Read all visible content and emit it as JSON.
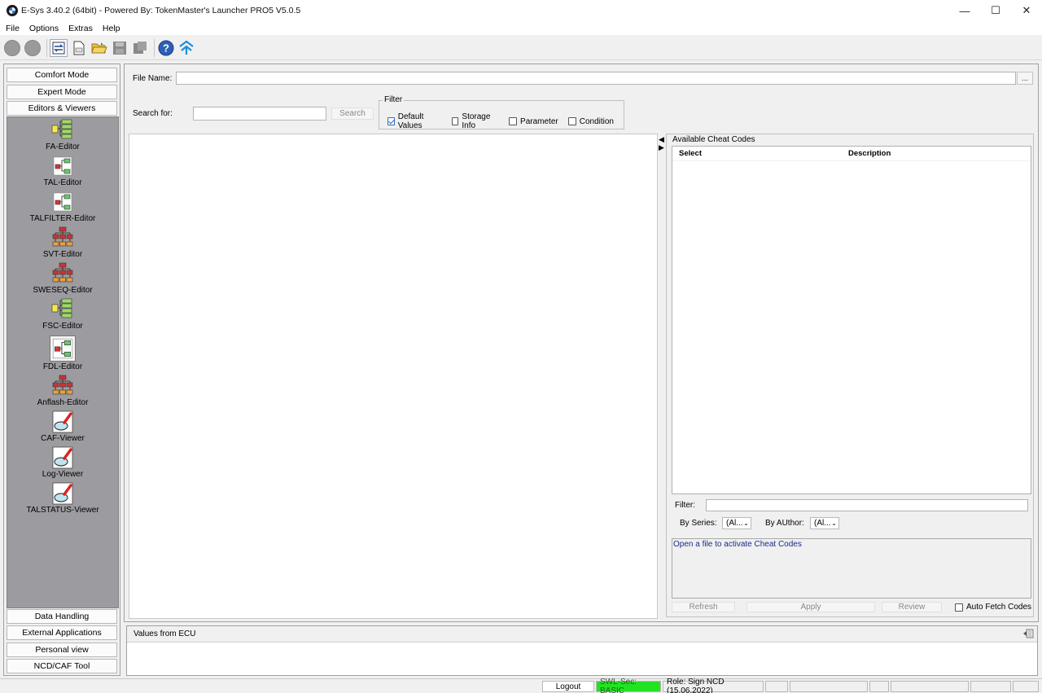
{
  "window": {
    "title": "E-Sys 3.40.2  (64bit) - Powered By: TokenMaster's Launcher PRO5 V5.0.5",
    "controls": [
      "minimize",
      "maximize",
      "close"
    ]
  },
  "menu": {
    "items": [
      "File",
      "Options",
      "Extras",
      "Help"
    ]
  },
  "toolbar": {
    "icons": [
      "back-icon",
      "forward-icon",
      "connect-icon",
      "new-file-icon",
      "open-folder-icon",
      "save-icon",
      "save-as-icon",
      "help-icon",
      "launcher-icon"
    ]
  },
  "sidebar": {
    "top_buttons": [
      "Comfort Mode",
      "Expert Mode",
      "Editors & Viewers"
    ],
    "editors": [
      {
        "label": "FA-Editor",
        "icon": "fa-editor-icon"
      },
      {
        "label": "TAL-Editor",
        "icon": "tal-editor-icon"
      },
      {
        "label": "TALFILTER-Editor",
        "icon": "talfilter-editor-icon"
      },
      {
        "label": "SVT-Editor",
        "icon": "svt-editor-icon"
      },
      {
        "label": "SWESEQ-Editor",
        "icon": "sweseq-editor-icon"
      },
      {
        "label": "FSC-Editor",
        "icon": "fsc-editor-icon"
      },
      {
        "label": "FDL-Editor",
        "icon": "fdl-editor-icon"
      },
      {
        "label": "Anflash-Editor",
        "icon": "anflash-editor-icon"
      },
      {
        "label": "CAF-Viewer",
        "icon": "caf-viewer-icon"
      },
      {
        "label": "Log-Viewer",
        "icon": "log-viewer-icon"
      },
      {
        "label": "TALSTATUS-Viewer",
        "icon": "talstatus-viewer-icon"
      }
    ],
    "bottom_buttons": [
      "Data Handling",
      "External Applications",
      "Personal view",
      "NCD/CAF Tool"
    ]
  },
  "main": {
    "file_name_label": "File Name:",
    "file_name_value": "",
    "browse_label": "...",
    "search_label": "Search for:",
    "search_value": "",
    "search_button": "Search",
    "filter": {
      "legend": "Filter",
      "options": [
        {
          "label": "Default Values",
          "checked": true
        },
        {
          "label": "Storage Info",
          "checked": false
        },
        {
          "label": "Parameter",
          "checked": false
        },
        {
          "label": "Condition",
          "checked": false
        }
      ]
    }
  },
  "cheat_codes": {
    "title": "Available Cheat Codes",
    "columns": [
      "Select",
      "Description"
    ],
    "rows": [],
    "filter_label": "Filter:",
    "filter_value": "",
    "by_series_label": "By Series:",
    "by_series_value": "(Al...",
    "by_author_label": "By AUthor:",
    "by_author_value": "(Al...",
    "info_text": "Open a file to activate Cheat Codes",
    "buttons": {
      "refresh": "Refresh",
      "apply": "Apply",
      "review": "Review"
    },
    "auto_fetch_label": "Auto Fetch Codes",
    "auto_fetch_checked": false
  },
  "values_panel": {
    "title": "Values from ECU"
  },
  "status": {
    "logout": "Logout",
    "swl_sec": "SWL-Sec: BASIC",
    "role": "Role: Sign NCD (15.06.2022)",
    "swl_color": "#21e321"
  }
}
